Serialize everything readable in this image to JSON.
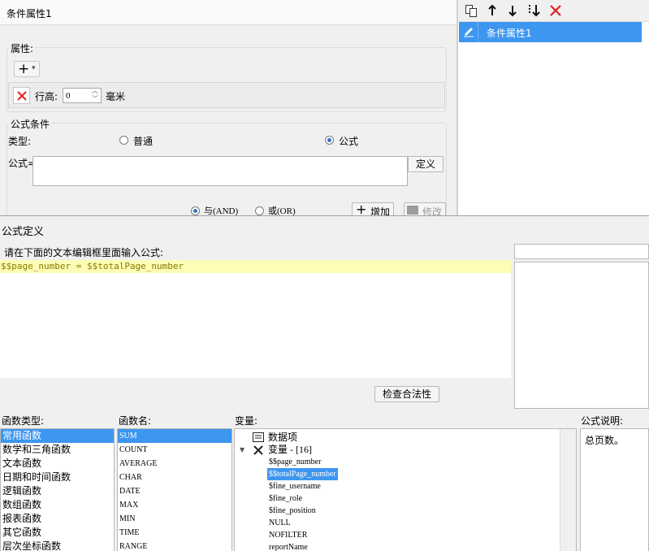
{
  "condition_panel": {
    "title": "条件属性1",
    "attr_group_label": "属性:",
    "add_button": "+",
    "add_dropdown": "▾",
    "row_height_label": "行高:",
    "row_height_value": "0",
    "row_height_unit": "毫米",
    "formula_group_label": "公式条件",
    "type_label": "类型:",
    "radio_normal": "普通",
    "radio_formula": "公式",
    "formula_label": "公式=",
    "define_button": "定义",
    "radio_and": "与(AND)",
    "radio_or": "或(OR)",
    "add_button_label": "增加",
    "modify_button_label": "修改"
  },
  "right_panel": {
    "list_items": [
      "条件属性1"
    ]
  },
  "formula_dialog": {
    "title": "公式定义",
    "instruction": "请在下面的文本编辑框里面输入公式:",
    "formula_text": "$$page_number = $$totalPage_number",
    "check_button": "检查合法性",
    "function_type_label": "函数类型:",
    "function_name_label": "函数名:",
    "variable_label": "变量:",
    "formula_desc_label": "公式说明:",
    "formula_desc_text": "总页数。",
    "function_types": [
      "常用函数",
      "数学和三角函数",
      "文本函数",
      "日期和时间函数",
      "逻辑函数",
      "数组函数",
      "报表函数",
      "其它函数",
      "层次坐标函数"
    ],
    "function_names": [
      "SUM",
      "COUNT",
      "AVERAGE",
      "CHAR",
      "DATE",
      "MAX",
      "MIN",
      "TIME",
      "RANGE"
    ],
    "variable_tree": {
      "data_item": "数据项",
      "variables_label": "变量 - [16]",
      "variables": [
        "$$page_number",
        "$$totalPage_number",
        "$fine_username",
        "$fine_role",
        "$fine_position",
        "NULL",
        "NOFILTER",
        "reportName"
      ]
    }
  },
  "colors": {
    "selection": "#3d96f0",
    "editor_highlight": "#fdfdb6",
    "formula_text": "#8a7a00",
    "delete_red": "#e02020"
  }
}
